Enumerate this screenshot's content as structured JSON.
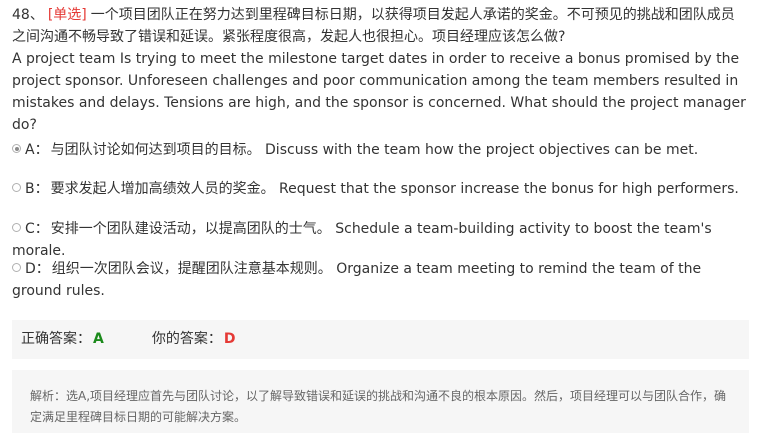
{
  "question": {
    "number": "48、",
    "type_tag": "[单选]",
    "text_cn": "一个项目团队正在努力达到里程碑目标日期，以获得项目发起人承诺的奖金。不可预见的挑战和团队成员之间沟通不畅导致了错误和延误。紧张程度很高，发起人也很担心。项目经理应该怎么做?",
    "text_en": "A project team Is trying to meet the milestone target dates in order to receive a bonus promised by the project sponsor. Unforeseen challenges and poor communication among the team members resulted in mistakes and delays. Tensions are high, and the sponsor is concerned. What should the project manager do?"
  },
  "options": [
    {
      "key": "A：",
      "text": "与团队讨论如何达到项目的目标。 Discuss with the team how the project objectives can be met.",
      "selected": true
    },
    {
      "key": "B：",
      "text": "要求发起人增加高绩效人员的奖金。 Request that the sponsor increase the bonus for high performers.",
      "selected": false
    },
    {
      "key": "C：",
      "text": "安排一个团队建设活动，以提高团队的士气。 Schedule a team-building activity to boost the team's morale.",
      "selected": false
    },
    {
      "key": "D：",
      "text": "组织一次团队会议，提醒团队注意基本规则。 Organize a team meeting to remind the team of the ground rules.",
      "selected": false
    }
  ],
  "answer": {
    "correct_label": "正确答案：",
    "correct_value": "A",
    "yours_label": "你的答案：",
    "yours_value": "D",
    "correct_color": "#1b8a1b",
    "wrong_color": "#e53935"
  },
  "explanation": {
    "text": "解析：选A,项目经理应首先与团队讨论，以了解导致错误和延误的挑战和沟通不良的根本原因。然后，项目经理可以与团队合作，确定满足里程碑目标日期的可能解决方案。"
  }
}
